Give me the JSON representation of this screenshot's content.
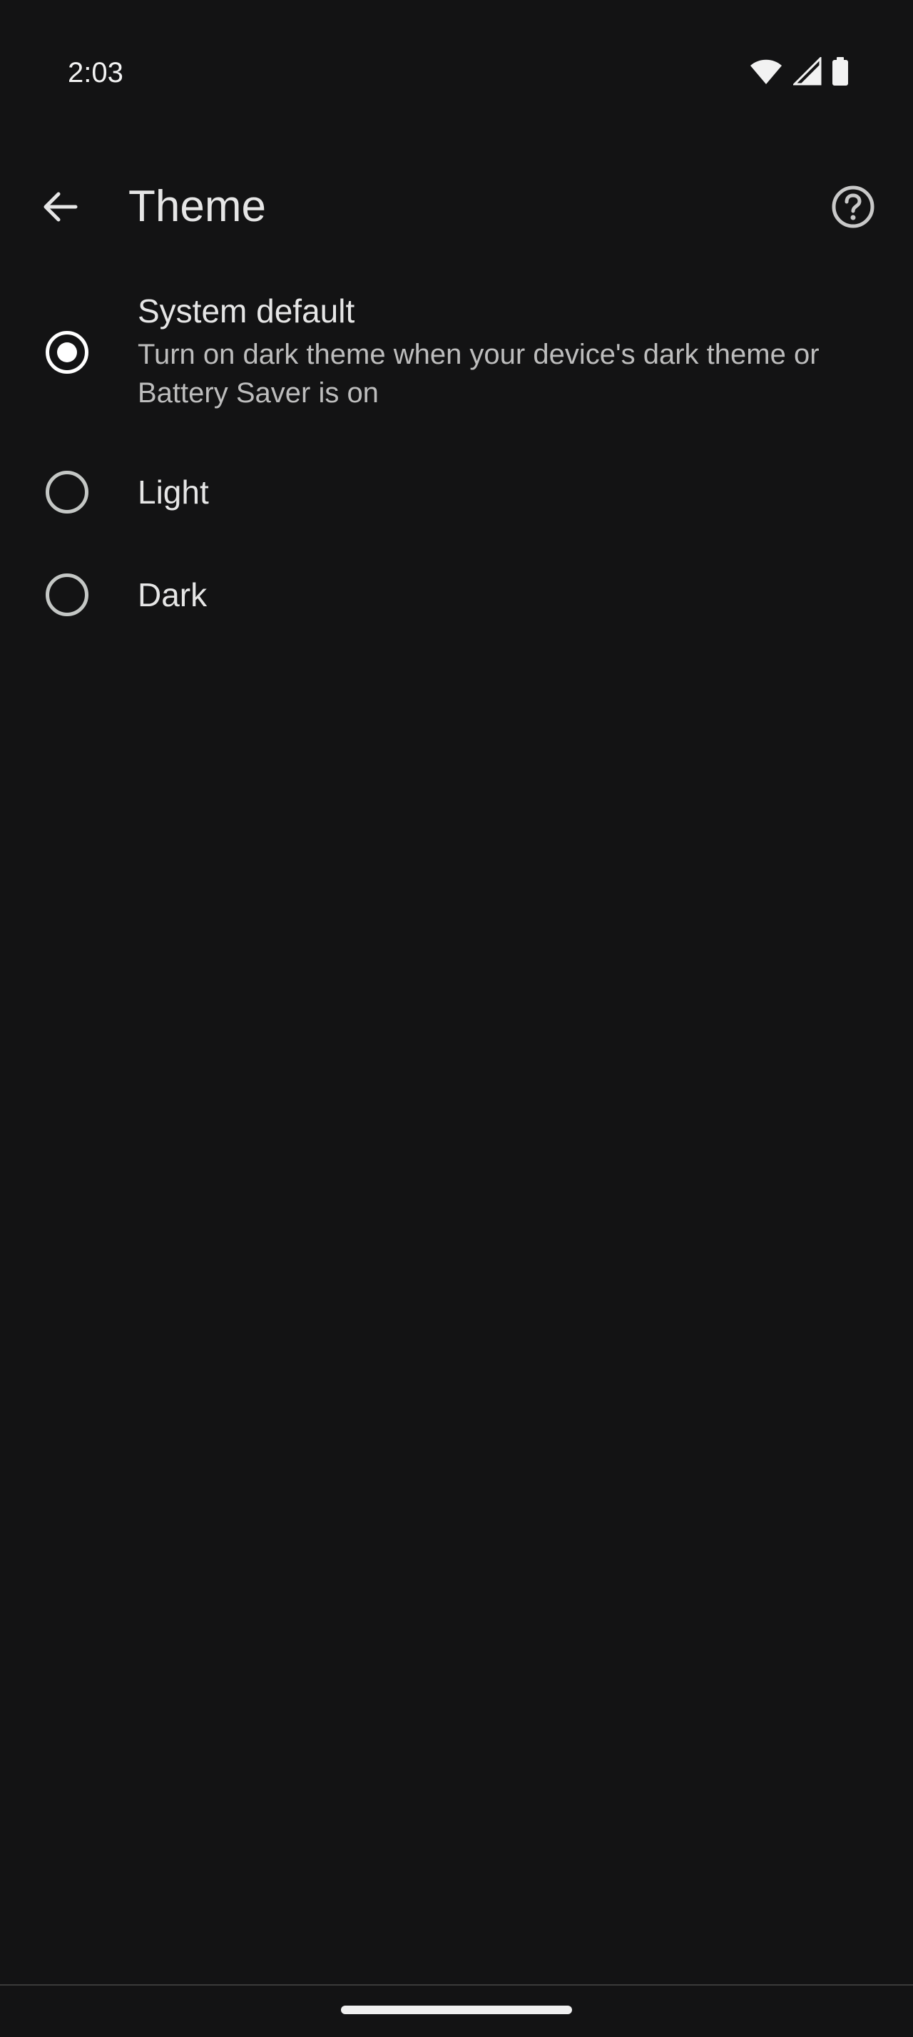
{
  "status_bar": {
    "time": "2:03",
    "icons": [
      "wifi-icon",
      "cellular-signal-icon",
      "battery-icon"
    ]
  },
  "app_bar": {
    "back_icon": "arrow-back-icon",
    "title": "Theme",
    "help_icon": "help-circle-icon"
  },
  "options": [
    {
      "label": "System default",
      "summary": "Turn on dark theme when your device's dark theme or Battery Saver is on",
      "selected": true
    },
    {
      "label": "Light",
      "selected": false
    },
    {
      "label": "Dark",
      "selected": false
    }
  ],
  "colors": {
    "background": "#131314",
    "text_primary": "#e6e6e6",
    "text_secondary": "#bdbdbd",
    "radio_unchecked": "#c4c7c5",
    "radio_checked": "#ffffff"
  }
}
